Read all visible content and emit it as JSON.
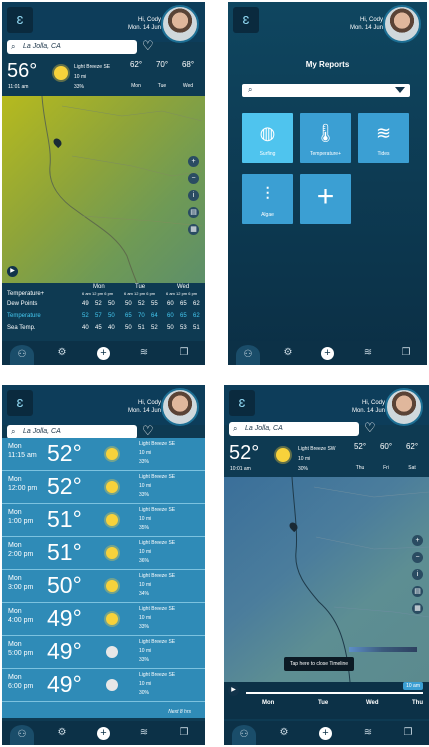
{
  "header": {
    "greeting": "Hi, Cody",
    "date": "Mon. 14 Jun"
  },
  "search": {
    "location": "La Jolla, CA"
  },
  "screen1": {
    "temp": "56°",
    "time": "11:01 am",
    "wind": "Light Breeze SE",
    "vis": "10 mi",
    "humidity": "33%",
    "forecast": [
      {
        "t": "62°",
        "d": "Mon"
      },
      {
        "t": "70°",
        "d": "Tue"
      },
      {
        "t": "68°",
        "d": "Wed"
      }
    ],
    "table": {
      "days": [
        "Mon",
        "Tue",
        "Wed"
      ],
      "times": "6 am 12 pm 6 pm",
      "rows": [
        {
          "label": "Temperature+",
          "vals": []
        },
        {
          "label": "Dew Points",
          "vals": [
            "49",
            "52",
            "50",
            "50",
            "52",
            "55",
            "60",
            "65",
            "62"
          ]
        },
        {
          "label": "Temperature",
          "vals": [
            "52",
            "57",
            "50",
            "65",
            "70",
            "64",
            "60",
            "65",
            "62"
          ]
        },
        {
          "label": "Sea Temp.",
          "vals": [
            "40",
            "45",
            "40",
            "50",
            "51",
            "52",
            "50",
            "53",
            "51"
          ]
        }
      ]
    }
  },
  "screen2": {
    "title": "My Reports",
    "tiles": [
      {
        "label": "Surfing",
        "icon": "surfboard-icon"
      },
      {
        "label": "Temperature+",
        "icon": "thermometer-icon"
      },
      {
        "label": "Tides",
        "icon": "waves-icon"
      },
      {
        "label": "Algae",
        "icon": "algae-icon"
      },
      {
        "label": "",
        "icon": "plus-icon"
      }
    ]
  },
  "screen3": {
    "rows": [
      {
        "day": "Mon",
        "time": "11:15 am",
        "temp": "52°",
        "wind": "Light Breeze SE",
        "vis": "10 mi",
        "hum": "33%"
      },
      {
        "day": "Mon",
        "time": "12:00 pm",
        "temp": "52°",
        "wind": "Light Breeze SE",
        "vis": "10 mi",
        "hum": "33%"
      },
      {
        "day": "Mon",
        "time": "1:00 pm",
        "temp": "51°",
        "wind": "Light Breeze SE",
        "vis": "10 mi",
        "hum": "35%"
      },
      {
        "day": "Mon",
        "time": "2:00 pm",
        "temp": "51°",
        "wind": "Light Breeze SE",
        "vis": "10 mi",
        "hum": "36%"
      },
      {
        "day": "Mon",
        "time": "3:00 pm",
        "temp": "50°",
        "wind": "Light Breeze SE",
        "vis": "10 mi",
        "hum": "34%"
      },
      {
        "day": "Mon",
        "time": "4:00 pm",
        "temp": "49°",
        "wind": "Light Breeze SE",
        "vis": "10 mi",
        "hum": "33%"
      },
      {
        "day": "Mon",
        "time": "5:00 pm",
        "temp": "49°",
        "wind": "Light Breeze SE",
        "vis": "10 mi",
        "hum": "33%"
      },
      {
        "day": "Mon",
        "time": "6:00 pm",
        "temp": "49°",
        "wind": "Light Breeze SE",
        "vis": "10 mi",
        "hum": "30%"
      }
    ],
    "next": "Next 8 hrs"
  },
  "screen4": {
    "temp": "52°",
    "time": "10:01 am",
    "wind": "Light Breeze SW",
    "vis": "10 mi",
    "humidity": "30%",
    "forecast": [
      {
        "t": "52°",
        "d": "Thu"
      },
      {
        "t": "60°",
        "d": "Fri"
      },
      {
        "t": "62°",
        "d": "Sat"
      }
    ],
    "tooltip": "Tap here to close Timeline",
    "badge": "10 am",
    "days": [
      "Mon",
      "Tue",
      "Wed",
      "Thu"
    ]
  },
  "colors": {
    "panel": "#0e3a52",
    "accent": "#3b9fd3",
    "sun": "#f7d23b"
  }
}
